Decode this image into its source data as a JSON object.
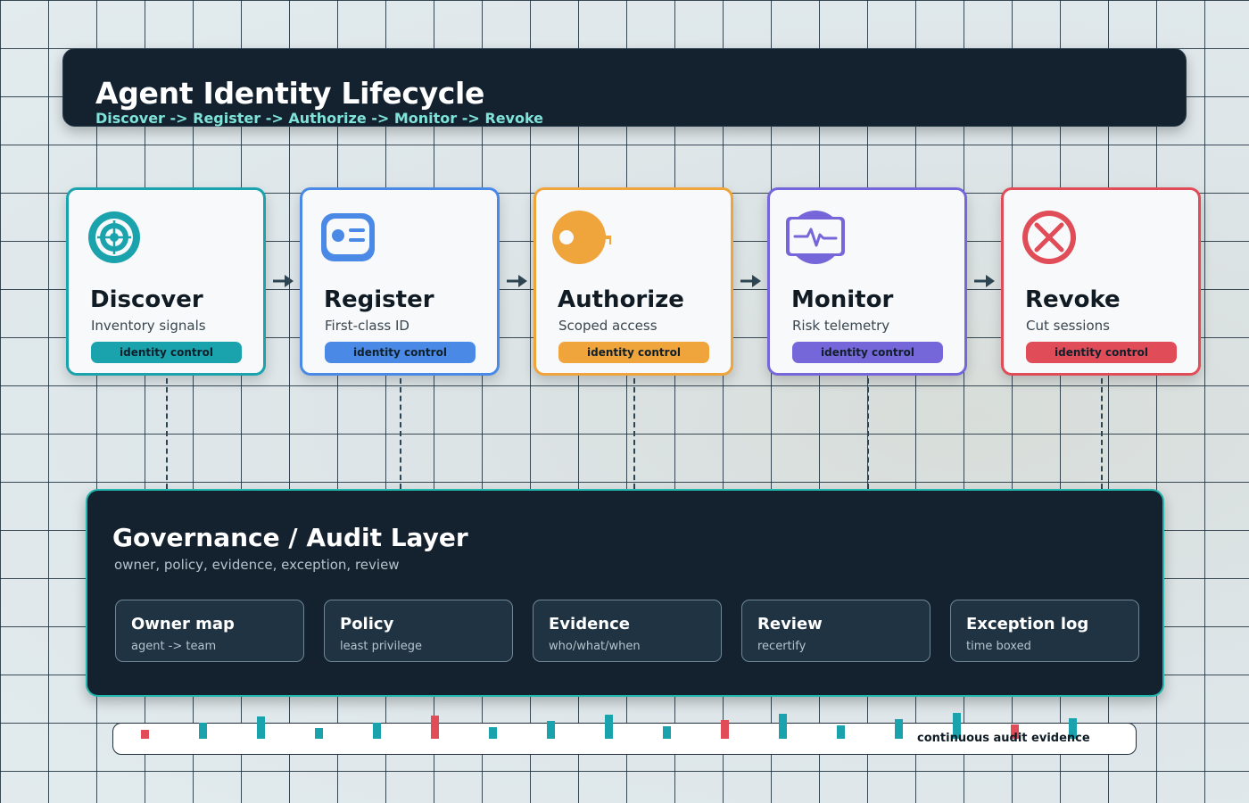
{
  "header": {
    "title": "Agent Identity Lifecycle",
    "subtitle": "Discover -> Register -> Authorize -> Monitor -> Revoke"
  },
  "stages": [
    {
      "name": "Discover",
      "desc": "Inventory signals",
      "tag": "identity control",
      "icon": "target-icon",
      "color": "#1aa3ad"
    },
    {
      "name": "Register",
      "desc": "First-class ID",
      "tag": "identity control",
      "icon": "id-card-icon",
      "color": "#4a8ae6"
    },
    {
      "name": "Authorize",
      "desc": "Scoped access",
      "tag": "identity control",
      "icon": "key-icon",
      "color": "#efa43c"
    },
    {
      "name": "Monitor",
      "desc": "Risk telemetry",
      "tag": "identity control",
      "icon": "pulse-monitor-icon",
      "color": "#7566d9"
    },
    {
      "name": "Revoke",
      "desc": "Cut sessions",
      "tag": "identity control",
      "icon": "cancel-x-icon",
      "color": "#e04c58"
    }
  ],
  "governance": {
    "title": "Governance / Audit Layer",
    "subtitle": "owner, policy, evidence, exception, review",
    "items": [
      {
        "name": "Owner map",
        "desc": "agent -> team"
      },
      {
        "name": "Policy",
        "desc": "least privilege"
      },
      {
        "name": "Evidence",
        "desc": "who/what/when"
      },
      {
        "name": "Review",
        "desc": "recertify"
      },
      {
        "name": "Exception log",
        "desc": "time boxed"
      }
    ]
  },
  "audit": {
    "label": "continuous audit evidence",
    "teal_color": "#1aa3ad",
    "red_color": "#e04c58"
  }
}
